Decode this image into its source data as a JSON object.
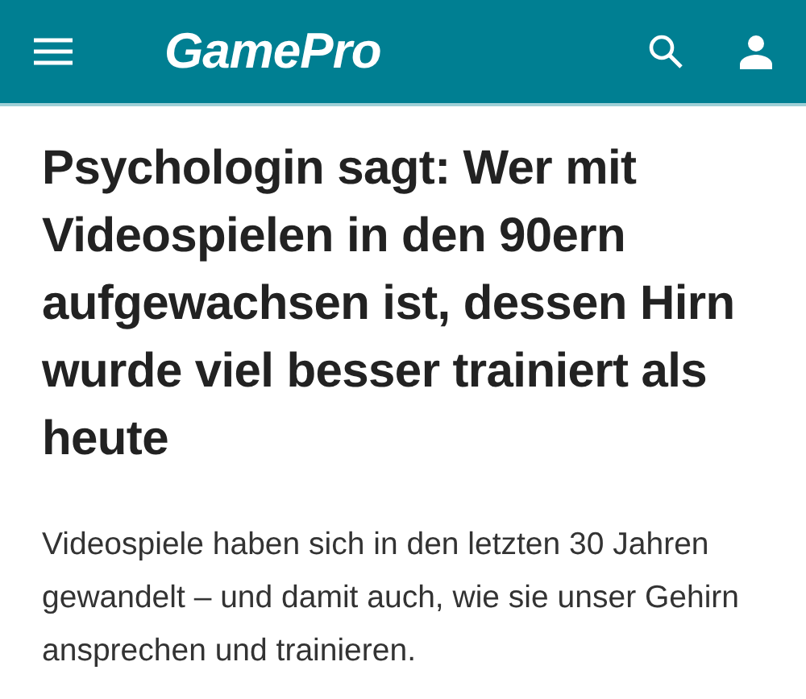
{
  "header": {
    "logo": "GamePro"
  },
  "article": {
    "headline": "Psychologin sagt: Wer mit Videospielen in den 90ern aufgewachsen ist, dessen Hirn wurde viel besser trainiert als heute",
    "teaser": "Videospiele haben sich in den letzten 30 Jahren gewandelt – und damit auch, wie sie unser Gehirn ansprechen und trainieren."
  }
}
